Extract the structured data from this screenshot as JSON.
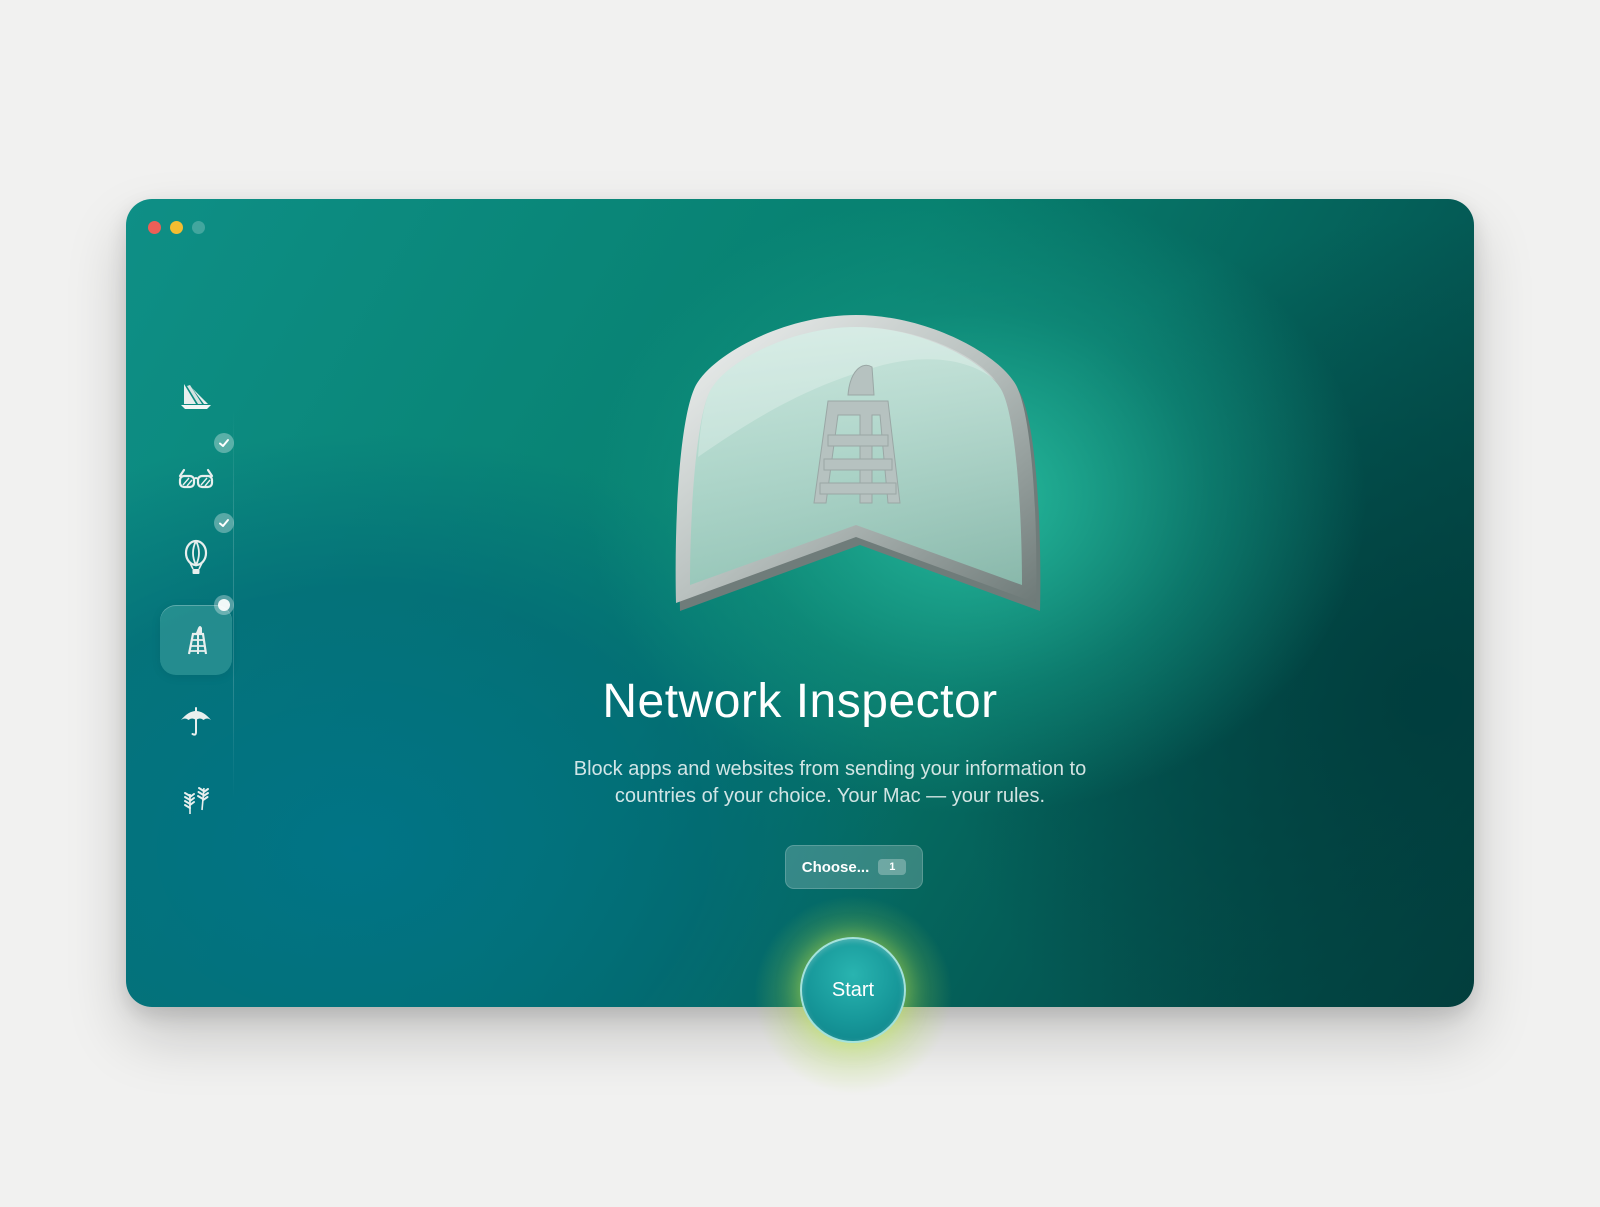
{
  "window": {
    "controls": [
      "close",
      "minimize",
      "zoom"
    ]
  },
  "sidebar": {
    "items": [
      {
        "icon": "ship-icon",
        "status": "none",
        "active": false
      },
      {
        "icon": "sunglasses-icon",
        "status": "done",
        "active": false
      },
      {
        "icon": "hot-air-balloon-icon",
        "status": "done",
        "active": false
      },
      {
        "icon": "lifeguard-tower-icon",
        "status": "in-progress",
        "active": true
      },
      {
        "icon": "umbrella-icon",
        "status": "none",
        "active": false
      },
      {
        "icon": "palm-leaves-icon",
        "status": "none",
        "active": false
      }
    ]
  },
  "main": {
    "hero_icon": "lifeguard-tower-shield-icon",
    "title": "Network Inspector",
    "description_line1": "Block apps and websites from sending your information to",
    "description_line2": "countries of your choice. Your Mac — your rules.",
    "choose_label": "Choose...",
    "choose_count": "1"
  },
  "start": {
    "label": "Start"
  },
  "colors": {
    "accent": "#17989a",
    "background": "#f1f1f0",
    "close": "#ed5f57",
    "minimize": "#f4bd31"
  }
}
